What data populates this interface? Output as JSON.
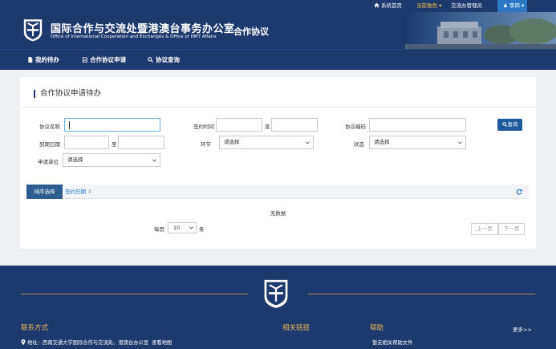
{
  "topbar": {
    "home": "系统首页",
    "current_role_label": "当前角色",
    "role": "交流办管理员",
    "user": "李四"
  },
  "header": {
    "title_cn": "国际合作与交流处暨港澳台事务办公室",
    "title_en": "Office of International Cooperation and Exchanges & Office of HMT Affairs",
    "system_name": "合作协议"
  },
  "nav": {
    "items": [
      {
        "label": "我的待办",
        "icon": "file-icon"
      },
      {
        "label": "合作协议申请",
        "icon": "document-icon"
      },
      {
        "label": "协议查询",
        "icon": "search-icon"
      }
    ]
  },
  "main": {
    "title": "合作协议申请待办",
    "filters": {
      "agreement_name": {
        "label": "协议名称",
        "value": ""
      },
      "sign_time": {
        "label": "签约时间",
        "from": "",
        "sep": "至",
        "to": ""
      },
      "agreement_code": {
        "label": "协议编码",
        "value": ""
      },
      "expire_date": {
        "label": "到期日期",
        "from": "",
        "sep": "至",
        "to": ""
      },
      "stage": {
        "label": "环节",
        "value": "请选择"
      },
      "status": {
        "label": "状态",
        "value": "请选择"
      },
      "applicant_unit": {
        "label": "申请单位",
        "value": "请选择"
      }
    },
    "search_button": "查询",
    "table": {
      "sort_tab": "排序选择",
      "sort_field": "签约日期",
      "sort_icon": "⇕",
      "empty_text": "无数据"
    },
    "pagination": {
      "per_page_label": "每页",
      "per_page": "10",
      "unit": "条",
      "prev": "上一页",
      "next": "下一页"
    }
  },
  "footer": {
    "contact_title": "联系方式",
    "links_title": "相关链接",
    "help_title": "帮助",
    "more": "更多>>",
    "address": "地址：西南交通大学国际合作与交流处、港澳台办公室",
    "map_link": "查看地图",
    "help_text": "暂无相关帮助文件"
  },
  "colors": {
    "navy": "#1c3a6e",
    "accent_blue": "#2c78c4",
    "gold": "#e7b852",
    "role_yellow": "#f5c242"
  }
}
